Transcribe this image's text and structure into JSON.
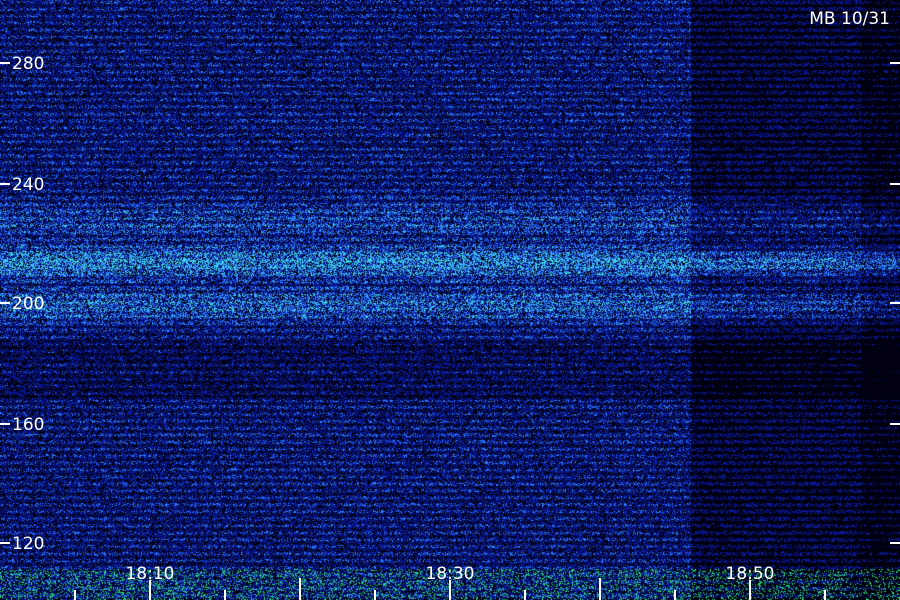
{
  "header": {
    "label": "MB 10/31"
  },
  "frequency_axis": {
    "ticks": [
      {
        "value": 280,
        "label": "280"
      },
      {
        "value": 240,
        "label": "240"
      },
      {
        "value": 200,
        "label": "200"
      },
      {
        "value": 160,
        "label": "160"
      },
      {
        "value": 120,
        "label": "120"
      }
    ],
    "range": [
      112,
      298
    ]
  },
  "time_axis": {
    "labels": [
      "18:10",
      "18:30",
      "18:50"
    ]
  },
  "colors": {
    "background": "#000010",
    "noise_low": "#0a1a9a",
    "noise_high": "#2f7dff",
    "band": "#3fd6e8",
    "baseline": "#2bd87a",
    "text": "#ffffff"
  }
}
